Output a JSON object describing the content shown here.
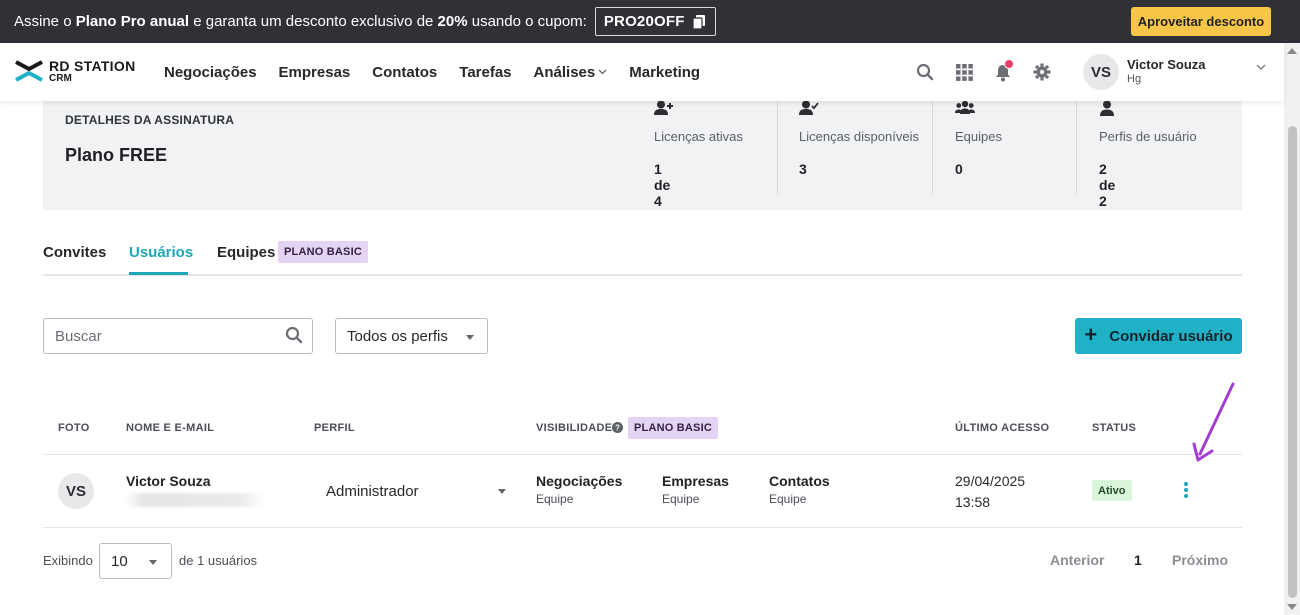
{
  "promo": {
    "text_before": "Assine o ",
    "plan_bold": "Plano Pro anual",
    "text_middle": " e garanta um desconto exclusivo de ",
    "discount_bold": "20%",
    "text_after": " usando o cupom:",
    "coupon": "PRO20OFF",
    "cta": "Aproveitar desconto",
    "cta_color": "#f7c548"
  },
  "nav": {
    "logo_line1": "RD STATION",
    "logo_line2": "CRM",
    "items": [
      {
        "label": "Negociações"
      },
      {
        "label": "Empresas"
      },
      {
        "label": "Contatos"
      },
      {
        "label": "Tarefas"
      },
      {
        "label": "Análises"
      },
      {
        "label": "Marketing"
      }
    ],
    "icons": [
      "search-icon",
      "apps-grid-icon",
      "bell-icon",
      "gear-icon"
    ],
    "user": {
      "initials": "VS",
      "name": "Victor Souza",
      "org": "Hg"
    }
  },
  "subscription": {
    "label": "DETALHES DA ASSINATURA",
    "plan": "Plano FREE",
    "stats": [
      {
        "label": "Licenças ativas",
        "value": "1 de 4",
        "icon": "user-plus-icon"
      },
      {
        "label": "Licenças disponíveis",
        "value": "3",
        "icon": "user-check-icon"
      },
      {
        "label": "Equipes",
        "value": "0",
        "icon": "users-group-icon"
      },
      {
        "label": "Perfis de usuário",
        "value": "2 de 2",
        "icon": "user-icon"
      }
    ]
  },
  "tabs": {
    "items": [
      {
        "label": "Convites"
      },
      {
        "label": "Usuários"
      },
      {
        "label": "Equipes"
      }
    ],
    "active": "Usuários",
    "badge": "PLANO BASIC",
    "accent": "#1fa7b8"
  },
  "filters": {
    "search_placeholder": "Buscar",
    "profile_select": "Todos os perfis",
    "invite_label": "Convidar usuário",
    "invite_color": "#1fb2c6"
  },
  "table": {
    "headers": {
      "photo": "FOTO",
      "name": "NOME E E-MAIL",
      "profile": "PERFIL",
      "visibility": "VISIBILIDADE",
      "visibility_badge": "PLANO BASIC",
      "last_access": "ÚLTIMO ACESSO",
      "status": "STATUS"
    },
    "rows": [
      {
        "initials": "VS",
        "name": "Victor Souza",
        "profile": "Administrador",
        "visibility": [
          {
            "title": "Negociações",
            "scope": "Equipe"
          },
          {
            "title": "Empresas",
            "scope": "Equipe"
          },
          {
            "title": "Contatos",
            "scope": "Equipe"
          }
        ],
        "last_access_date": "29/04/2025",
        "last_access_time": "13:58",
        "status": "Ativo",
        "status_color": "#d9f5dc"
      }
    ]
  },
  "pagination": {
    "showing": "Exibindo",
    "per_page": "10",
    "total": "de 1 usuários",
    "prev": "Anterior",
    "page": "1",
    "next": "Próximo"
  },
  "annotation_color": "#a23fd0"
}
